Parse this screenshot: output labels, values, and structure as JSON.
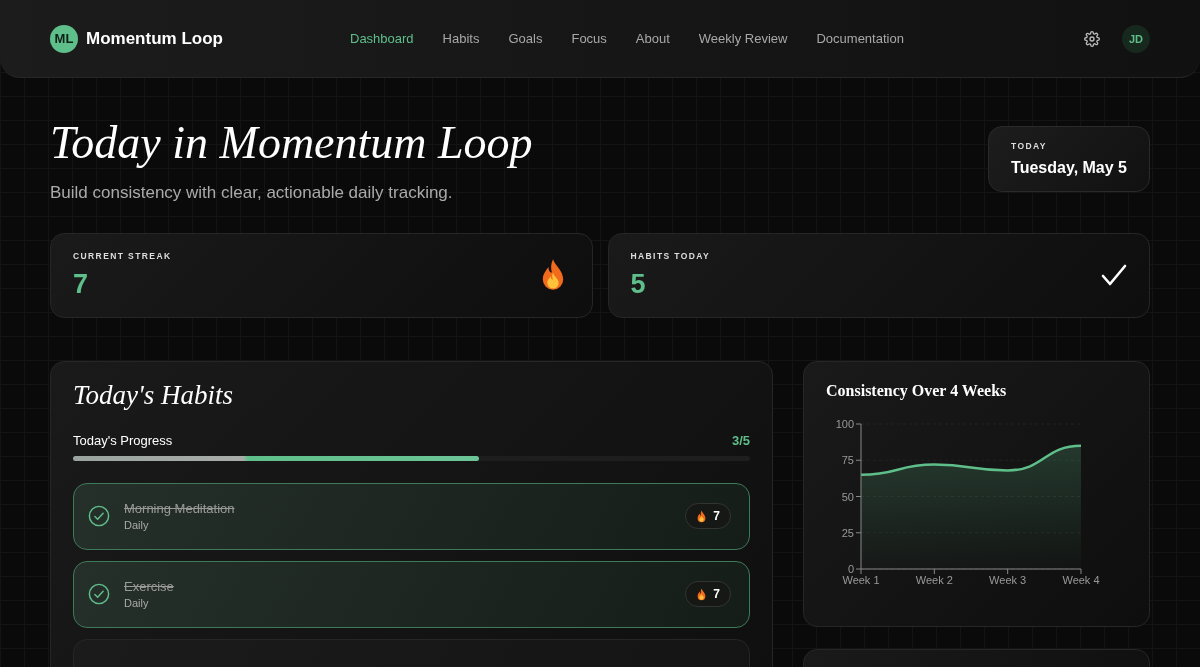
{
  "nav": {
    "logo_initials": "ML",
    "brand": "Momentum Loop",
    "links": [
      {
        "label": "Dashboard",
        "selected": true
      },
      {
        "label": "Habits",
        "selected": false
      },
      {
        "label": "Goals",
        "selected": false
      },
      {
        "label": "Focus",
        "selected": false
      },
      {
        "label": "About",
        "selected": false
      },
      {
        "label": "Weekly Review",
        "selected": false
      },
      {
        "label": "Documentation",
        "selected": false
      }
    ],
    "avatar_initials": "JD"
  },
  "hero": {
    "title": "Today in Momentum Loop",
    "subtitle": "Build consistency with clear, actionable daily tracking.",
    "date_label": "TODAY",
    "date": "Tuesday, May 5"
  },
  "stats": [
    {
      "label": "CURRENT STREAK",
      "value": "7",
      "kind": "flame"
    },
    {
      "label": "HABITS TODAY",
      "value": "5",
      "kind": "check"
    }
  ],
  "habits": {
    "title": "Today's Habits",
    "progress_label": "Today's Progress",
    "progress_count": "3/5",
    "level": 0.6,
    "items": [
      {
        "name": "Morning Meditation",
        "frequency": "Daily",
        "streak": "7",
        "checked": true
      },
      {
        "name": "Exercise",
        "frequency": "Daily",
        "streak": "7",
        "checked": true
      }
    ]
  },
  "consistency": {
    "title": "Consistency Over 4 Weeks",
    "chart_data": {
      "type": "area",
      "categories": [
        "Week 1",
        "Week 2",
        "Week 3",
        "Week 4"
      ],
      "series": [
        {
          "color": "#5fbf8a",
          "values": [
            65,
            72,
            68,
            85
          ]
        }
      ],
      "grid": true,
      "ylim": [
        0,
        100
      ],
      "yticks": [
        0,
        25,
        50,
        75,
        100
      ]
    }
  }
}
